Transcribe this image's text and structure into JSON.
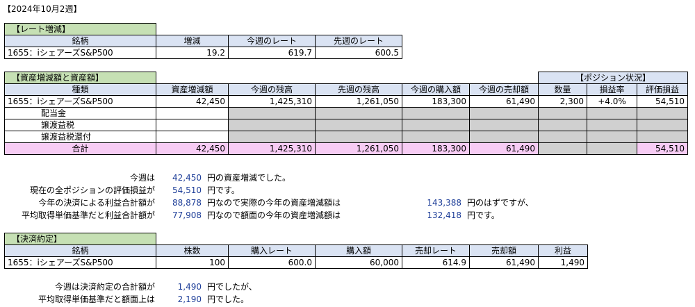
{
  "page_title": "【2024年10月2週】",
  "rate": {
    "title": "【レート増減】",
    "headers": [
      "銘柄",
      "増減",
      "今週のレート",
      "先週のレート"
    ],
    "row": [
      "1655：iシェアーズS&P500",
      "19.2",
      "619.7",
      "600.5"
    ]
  },
  "assets": {
    "title": "【資産増減額と資産額】",
    "position_title": "【ポジション状況】",
    "headers": [
      "種類",
      "資産増減額",
      "今週の残高",
      "先週の残高",
      "今週の購入額",
      "今週の売却額",
      "数量",
      "損益率",
      "評価損益"
    ],
    "rows": [
      [
        "1655：iシェアーズS&P500",
        "42,450",
        "1,425,310",
        "1,261,050",
        "183,300",
        "61,490",
        "2,300",
        "+4.0%",
        "54,510"
      ],
      [
        "配当金"
      ],
      [
        "譲渡益税"
      ],
      [
        "譲渡益税還付"
      ]
    ],
    "total": [
      "合計",
      "42,450",
      "1,425,310",
      "1,261,050",
      "183,300",
      "61,490",
      "",
      "",
      "54,510"
    ]
  },
  "summary": {
    "l1_label": "今週は",
    "l1_value": "42,450",
    "l1_text": "円の資産増減でした。",
    "l2_label": "現在の全ポジションの評価損益が",
    "l2_value": "54,510",
    "l2_text": "円です。",
    "l3_label": "今年の決済による利益合計額が",
    "l3_value": "88,878",
    "l3_text": "円なので実際の今年の資産増減額は",
    "l3_value2": "143,388",
    "l3_text2": "円のはずですが、",
    "l4_label": "平均取得単価基準だと利益合計額が",
    "l4_value": "77,908",
    "l4_text": "円なので額面の今年の資産増減額は",
    "l4_value2": "132,418",
    "l4_text2": "円です。"
  },
  "settlement": {
    "title": "【決済約定】",
    "headers": [
      "銘柄",
      "株数",
      "購入レート",
      "購入額",
      "売却レート",
      "売却額",
      "利益"
    ],
    "row": [
      "1655：iシェアーズS&P500",
      "100",
      "600.0",
      "60,000",
      "614.9",
      "61,490",
      "1,490"
    ]
  },
  "bottom": {
    "l1_label": "今週は決済約定の合計額が",
    "l1_value": "1,490",
    "l1_text": "円でしたが、",
    "l2_label": "平均取得単価基準だと額面上は",
    "l2_value": "2,190",
    "l2_text": "円でした。"
  }
}
